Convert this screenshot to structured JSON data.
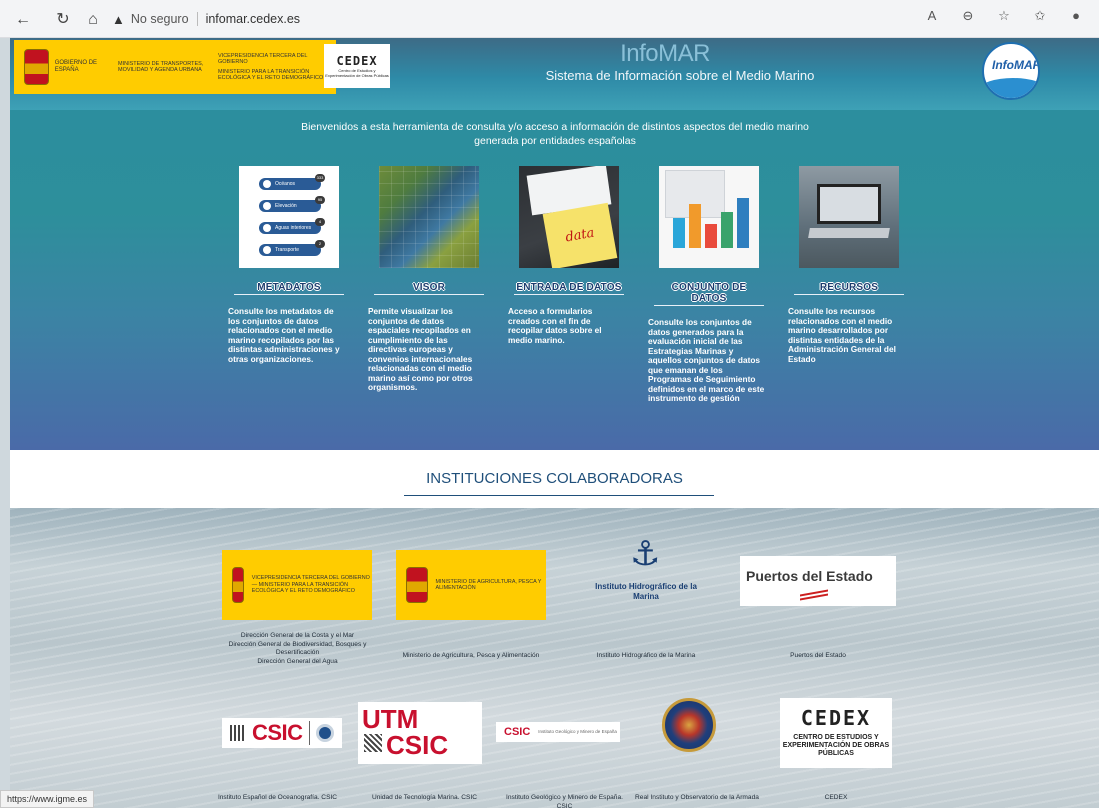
{
  "browser": {
    "security_label": "No seguro",
    "url": "infomar.cedex.es",
    "status_url": "https://www.igme.es"
  },
  "header": {
    "gov_left": "Gobierno de España",
    "gov_mid": "Ministerio de Transportes, Movilidad y Agenda Urbana",
    "gov_vice": "Vicepresidencia Tercera del Gobierno",
    "gov_transicion": "Ministerio para la Transición Ecológica y el Reto Demográfico",
    "cedex_short": "CEDEX",
    "cedex_sub": "Centro de Estudios y Experimentación de Obras Públicas",
    "title": "InfoMAR",
    "subtitle": "Sistema de Información sobre el Medio Marino",
    "logo_text": "InfoMAR"
  },
  "welcome": "Bienvenidos a esta herramienta de consulta y/o acceso a información de distintos aspectos del medio marino generada por entidades españolas",
  "cards": [
    {
      "caption": "METADATOS",
      "desc": "Consulte los metadatos de los conjuntos de datos relacionados con el medio marino recopilados por las distintas administraciones y otras organizaciones.",
      "pills": [
        {
          "label": "Océanos",
          "count": "333"
        },
        {
          "label": "Elevación",
          "count": "95"
        },
        {
          "label": "Aguas interiores",
          "count": "4"
        },
        {
          "label": "Transporte",
          "count": "2"
        }
      ]
    },
    {
      "caption": "VISOR",
      "desc": "Permite visualizar los conjuntos de datos espaciales recopilados en cumplimiento de las directivas europeas y convenios internacionales relacionadas con el medio marino así como por otros organismos."
    },
    {
      "caption": "ENTRADA DE DATOS",
      "desc": "Acceso a formularios creados con el fin de recopilar datos sobre el medio marino.",
      "note": "data entry"
    },
    {
      "caption": "CONJUNTO DE DATOS",
      "desc": "Consulte los conjuntos de datos generados para la evaluación inicial de las Estrategias Marinas y aquellos conjuntos de datos que emanan de los Programas de Seguimiento definidos en el marco de este instrumento de gestión"
    },
    {
      "caption": "RECURSOS",
      "desc": "Consulte los recursos relacionados con el medio marino desarrollados por distintas entidades de la Administración General del Estado"
    }
  ],
  "section_title": "INSTITUCIONES COLABORADORAS",
  "institutions": {
    "row1": [
      {
        "logo_text": "Vicepresidencia Tercera del Gobierno — Ministerio para la Transición Ecológica y el Reto Demográfico",
        "caption_lines": [
          "Dirección General de la Costa y el Mar",
          "Dirección General de Biodiversidad, Bosques y Desertificación",
          "Dirección General del Agua"
        ]
      },
      {
        "logo_text": "Ministerio de Agricultura, Pesca y Alimentación",
        "caption_lines": [
          "Ministerio de Agricultura, Pesca y Alimentación"
        ]
      },
      {
        "logo_text": "Instituto Hidrográfico de la Marina",
        "caption_lines": [
          "Instituto Hidrográfico de la Marina"
        ]
      },
      {
        "logo_text": "Puertos del Estado",
        "caption_lines": [
          "Puertos del Estado"
        ]
      }
    ],
    "row2": [
      {
        "logo_text": "CSIC",
        "caption": "Instituto Español de Oceanografía. CSIC"
      },
      {
        "logo_text_top": "UTM",
        "logo_text_bot": "CSIC",
        "caption": "Unidad de Tecnología Marina. CSIC"
      },
      {
        "logo_text": "CSIC",
        "logo_sub": "Instituto Geológico y Minero de España",
        "caption": "Instituto Geológico y Minero de España. CSIC"
      },
      {
        "caption": "Real Instituto y Observatorio de la Armada"
      },
      {
        "logo_text": "CEDEX",
        "logo_sub": "CENTRO DE ESTUDIOS Y EXPERIMENTACIÓN DE OBRAS PÚBLICAS",
        "caption": "CEDEX"
      }
    ]
  }
}
